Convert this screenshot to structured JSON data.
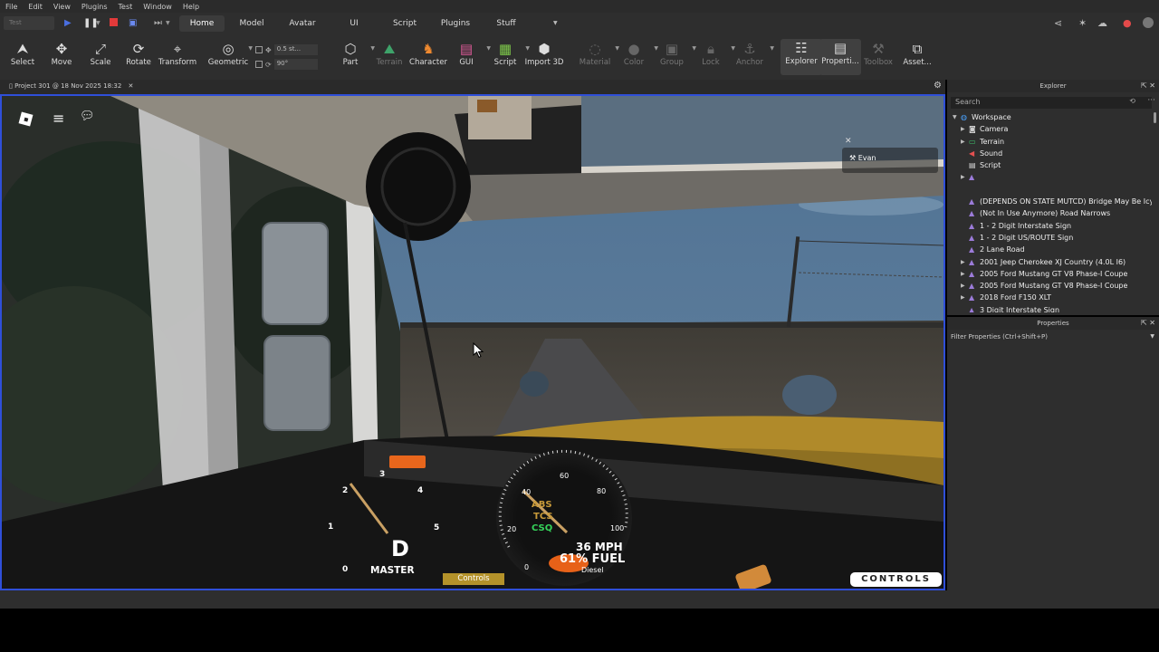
{
  "menu": [
    "File",
    "Edit",
    "View",
    "Plugins",
    "Test",
    "Window",
    "Help"
  ],
  "play_field": "Test",
  "tabs": {
    "home": "Home",
    "model": "Model",
    "avatar": "Avatar",
    "ui": "UI",
    "script": "Script",
    "plugins": "Plugins",
    "stuff": "Stuff"
  },
  "toolbar": {
    "select": "Select",
    "move": "Move",
    "scale": "Scale",
    "rotate": "Rotate",
    "transform": "Transform",
    "geometric": "Geometric",
    "snap_move": "0.5 st...",
    "snap_rotate": "90°",
    "part": "Part",
    "terrain": "Terrain",
    "character": "Character",
    "gui": "GUI",
    "script": "Script",
    "import3d": "Import 3D",
    "material": "Material",
    "color": "Color",
    "group": "Group",
    "lock": "Lock",
    "anchor": "Anchor",
    "explorer": "Explorer",
    "properties": "Properti...",
    "toolbox": "Toolbox",
    "assets": "Asset..."
  },
  "document_tab": "Project 301 @ 18 Nov 2025 18:32",
  "viewport": {
    "player_name": "Evan",
    "gear": "D",
    "master": "MASTER",
    "controls_pill": "Controls",
    "controls_button": "CONTROLS",
    "speed": "36 MPH",
    "fuel": "61% FUEL",
    "fuel_type": "Diesel",
    "warn_abs": "ABS",
    "warn_tcs": "TCS",
    "warn_csq": "CSQ",
    "tach_numbers": [
      "0",
      "1",
      "2",
      "3",
      "4",
      "5"
    ],
    "speed_numbers": [
      "0",
      "20",
      "40",
      "60",
      "80",
      "100"
    ]
  },
  "explorer": {
    "title": "Explorer",
    "search_placeholder": "Search",
    "items": [
      {
        "label": "Workspace",
        "icon": "workspace-icon",
        "indent": 0,
        "arrow": "▼",
        "color": "#4aa3ff"
      },
      {
        "label": "Camera",
        "icon": "camera-icon",
        "indent": 1,
        "arrow": "▶",
        "color": "#ccc"
      },
      {
        "label": "Terrain",
        "icon": "terrain-icon",
        "indent": 1,
        "arrow": "▶",
        "color": "#3ec46d"
      },
      {
        "label": "Sound",
        "icon": "sound-icon",
        "indent": 1,
        "arrow": "",
        "color": "#e35050"
      },
      {
        "label": "Script",
        "icon": "script-icon",
        "indent": 1,
        "arrow": "",
        "color": "#ddd"
      },
      {
        "label": "",
        "icon": "model-icon",
        "indent": 1,
        "arrow": "▶",
        "color": "#9b7bd9"
      },
      {
        "label": "",
        "icon": "",
        "indent": 1,
        "arrow": "",
        "color": "#ccc"
      },
      {
        "label": "(DEPENDS ON STATE MUTCD) Bridge May Be Icy",
        "icon": "model-icon",
        "indent": 1,
        "arrow": "",
        "color": "#9b7bd9"
      },
      {
        "label": "(Not In Use Anymore) Road Narrows",
        "icon": "model-icon",
        "indent": 1,
        "arrow": "",
        "color": "#9b7bd9"
      },
      {
        "label": "1 - 2 Digit Interstate Sign",
        "icon": "model-icon",
        "indent": 1,
        "arrow": "",
        "color": "#9b7bd9"
      },
      {
        "label": "1 - 2 Digit US/ROUTE Sign",
        "icon": "model-icon",
        "indent": 1,
        "arrow": "",
        "color": "#9b7bd9"
      },
      {
        "label": "2 Lane Road",
        "icon": "model-icon",
        "indent": 1,
        "arrow": "",
        "color": "#9b7bd9"
      },
      {
        "label": "2001 Jeep Cherokee XJ Country (4.0L I6)",
        "icon": "model-icon",
        "indent": 1,
        "arrow": "▶",
        "color": "#9b7bd9"
      },
      {
        "label": "2005 Ford Mustang GT V8 Phase-I Coupe",
        "icon": "model-icon",
        "indent": 1,
        "arrow": "▶",
        "color": "#9b7bd9"
      },
      {
        "label": "2005 Ford Mustang GT V8 Phase-I Coupe",
        "icon": "model-icon",
        "indent": 1,
        "arrow": "▶",
        "color": "#9b7bd9"
      },
      {
        "label": "2018 Ford F150 XLT",
        "icon": "model-icon",
        "indent": 1,
        "arrow": "▶",
        "color": "#9b7bd9"
      },
      {
        "label": "3 Digit Interstate Sign",
        "icon": "model-icon",
        "indent": 1,
        "arrow": "",
        "color": "#9b7bd9"
      }
    ]
  },
  "properties": {
    "title": "Properties",
    "filter_placeholder": "Filter Properties (Ctrl+Shift+P)"
  },
  "colors": {
    "accent_tab": "#3b3b3b",
    "viewport_border": "#2f4fd9",
    "warning_amber": "#c89a3a",
    "warning_green": "#35d35a"
  }
}
